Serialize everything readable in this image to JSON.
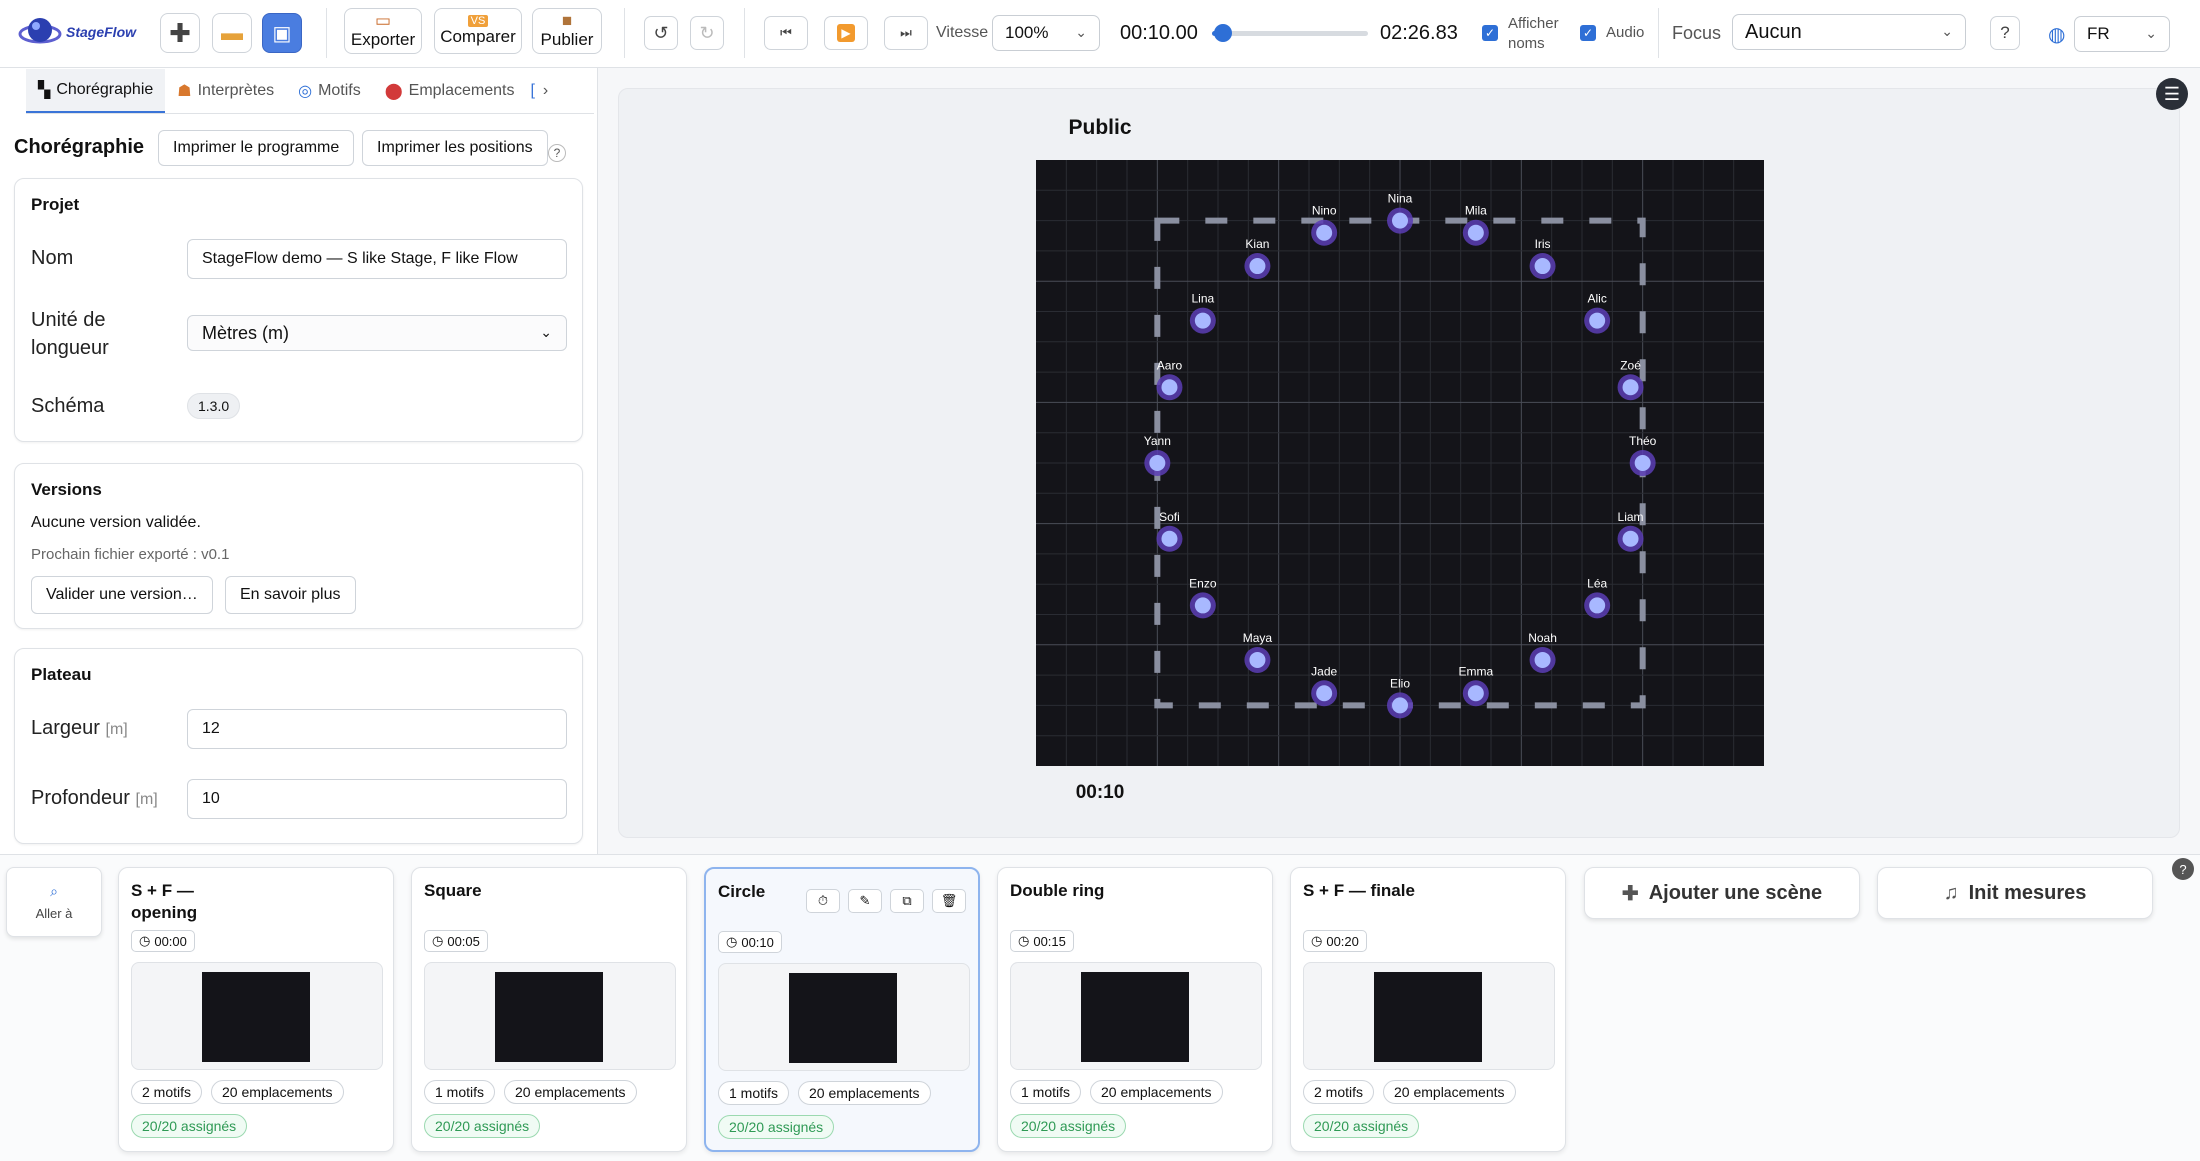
{
  "app": {
    "name": "StageFlow"
  },
  "toolbar": {
    "new_label": "+",
    "export_label": "Exporter",
    "compare_label": "Comparer",
    "compare_badge": "VS",
    "publish_label": "Publier",
    "speed_label": "Vitesse",
    "speed_value": "100%",
    "time_current": "00:10.00",
    "time_total": "02:26.83",
    "playhead_fraction": 0.068,
    "show_names_label": "Afficher noms",
    "audio_label": "Audio",
    "focus_label": "Focus",
    "focus_value": "Aucun",
    "help_label": "?",
    "language_value": "FR"
  },
  "tabs": [
    {
      "label": "Chorégraphie",
      "icon": "clapper-icon"
    },
    {
      "label": "Interprètes",
      "icon": "dancers-icon"
    },
    {
      "label": "Motifs",
      "icon": "swirl-icon"
    },
    {
      "label": "Emplacements",
      "icon": "pin-icon"
    }
  ],
  "panel": {
    "title": "Chorégraphie",
    "print_program": "Imprimer le programme",
    "print_positions": "Imprimer les positions",
    "help": "?",
    "project": {
      "title": "Projet",
      "name_label": "Nom",
      "name_value": "StageFlow demo — S like Stage, F like Flow",
      "unit_label_1": "Unité de",
      "unit_label_2": "longueur",
      "unit_value": "Mètres (m)",
      "schema_label": "Schéma",
      "schema_value": "1.3.0"
    },
    "versions": {
      "title": "Versions",
      "none_text": "Aucune version validée.",
      "next_text": "Prochain fichier exporté : v0.1",
      "validate_btn": "Valider une version…",
      "learn_btn": "En savoir plus"
    },
    "stage": {
      "title": "Plateau",
      "width_label": "Largeur",
      "depth_label": "Profondeur",
      "unit": "[m]",
      "width_value": "12",
      "depth_value": "10"
    }
  },
  "stage": {
    "audience_label": "Public",
    "time_label": "00:10",
    "dancers": [
      {
        "name": "Nina",
        "x": 0.0,
        "y": 4.0
      },
      {
        "name": "Nino",
        "x": -1.25,
        "y": 3.8
      },
      {
        "name": "Mila",
        "x": 1.25,
        "y": 3.8
      },
      {
        "name": "Kian",
        "x": -2.35,
        "y": 3.25
      },
      {
        "name": "Iris",
        "x": 2.35,
        "y": 3.25
      },
      {
        "name": "Lina",
        "x": -3.25,
        "y": 2.35
      },
      {
        "name": "Alic",
        "x": 3.25,
        "y": 2.35
      },
      {
        "name": "Aaro",
        "x": -3.8,
        "y": 1.25
      },
      {
        "name": "Zoé",
        "x": 3.8,
        "y": 1.25
      },
      {
        "name": "Yann",
        "x": -4.0,
        "y": 0.0
      },
      {
        "name": "Théo",
        "x": 4.0,
        "y": 0.0
      },
      {
        "name": "Sofi",
        "x": -3.8,
        "y": -1.25
      },
      {
        "name": "Liam",
        "x": 3.8,
        "y": -1.25
      },
      {
        "name": "Enzo",
        "x": -3.25,
        "y": -2.35
      },
      {
        "name": "Léa",
        "x": 3.25,
        "y": -2.35
      },
      {
        "name": "Maya",
        "x": -2.35,
        "y": -3.25
      },
      {
        "name": "Noah",
        "x": 2.35,
        "y": -3.25
      },
      {
        "name": "Jade",
        "x": -1.25,
        "y": -3.8
      },
      {
        "name": "Emma",
        "x": 1.25,
        "y": -3.8
      },
      {
        "name": "Elio",
        "x": 0.0,
        "y": -4.0
      }
    ]
  },
  "bottom": {
    "goto_label": "Aller à",
    "add_scene": "Ajouter une scène",
    "init_measures": "Init mesures",
    "help": "?",
    "scenes": [
      {
        "title": "S + F — opening",
        "time": "00:00",
        "motifs": "2 motifs",
        "slots": "20 emplacements",
        "assigned": "20/20 assignés",
        "active": false
      },
      {
        "title": "Square",
        "time": "00:05",
        "motifs": "1 motifs",
        "slots": "20 emplacements",
        "assigned": "20/20 assignés",
        "active": false
      },
      {
        "title": "Circle",
        "time": "00:10",
        "motifs": "1 motifs",
        "slots": "20 emplacements",
        "assigned": "20/20 assignés",
        "active": true
      },
      {
        "title": "Double ring",
        "time": "00:15",
        "motifs": "1 motifs",
        "slots": "20 emplacements",
        "assigned": "20/20 assignés",
        "active": false
      },
      {
        "title": "S + F — finale",
        "time": "00:20",
        "motifs": "2 motifs",
        "slots": "20 emplacements",
        "assigned": "20/20 assignés",
        "active": false
      }
    ]
  },
  "colors": {
    "accent": "#2e6fd6",
    "stage_bg": "#141419",
    "dancer_fill": "#a8b8ff",
    "dancer_ring": "#5b3db5"
  }
}
